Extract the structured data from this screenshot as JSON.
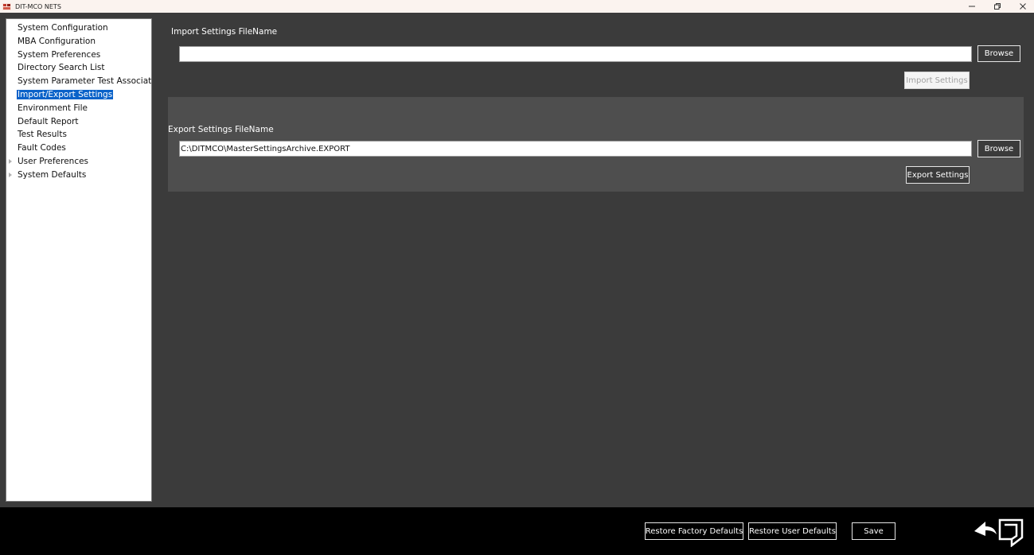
{
  "window": {
    "title": "DIT-MCO NETS",
    "app_icon_glyph": "NETS",
    "controls": [
      "minimize-icon",
      "restore-icon",
      "close-icon"
    ]
  },
  "sidebar": {
    "items": [
      {
        "label": "System Configuration",
        "selected": false,
        "expandable": false
      },
      {
        "label": "MBA Configuration",
        "selected": false,
        "expandable": false
      },
      {
        "label": "System Preferences",
        "selected": false,
        "expandable": false
      },
      {
        "label": "Directory Search List",
        "selected": false,
        "expandable": false
      },
      {
        "label": "System Parameter Test Associations",
        "selected": false,
        "expandable": false
      },
      {
        "label": "Import/Export Settings",
        "selected": true,
        "expandable": false
      },
      {
        "label": "Environment File",
        "selected": false,
        "expandable": false
      },
      {
        "label": "Default Report",
        "selected": false,
        "expandable": false
      },
      {
        "label": "Test Results",
        "selected": false,
        "expandable": false
      },
      {
        "label": "Fault Codes",
        "selected": false,
        "expandable": false
      },
      {
        "label": "User Preferences",
        "selected": false,
        "expandable": true
      },
      {
        "label": "System Defaults",
        "selected": false,
        "expandable": true
      }
    ]
  },
  "import": {
    "label": "Import Settings FileName",
    "value": "",
    "browse_label": "Browse",
    "action_label": "Import Settings",
    "action_enabled": false
  },
  "export": {
    "label": "Export Settings FileName",
    "value": "C:\\DITMCO\\MasterSettingsArchive.EXPORT",
    "browse_label": "Browse",
    "action_label": "Export Settings",
    "action_enabled": true
  },
  "footer": {
    "restore_factory_label": "Restore Factory Defaults",
    "restore_user_label": "Restore User Defaults",
    "save_label": "Save",
    "back_icon": "back-arrow-icon"
  },
  "colors": {
    "background": "#3b3b3b",
    "panel": "#4e4e4e",
    "selection": "#0a62c9",
    "footer": "#000000"
  }
}
